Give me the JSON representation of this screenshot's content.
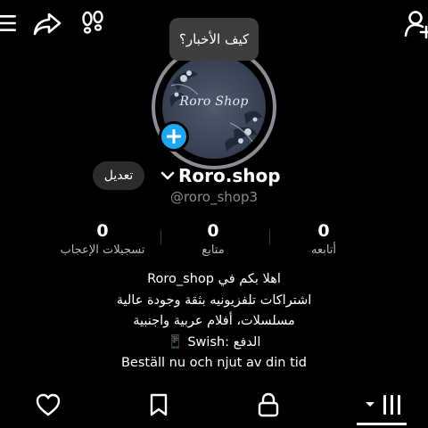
{
  "top_bar": {
    "icons": [
      "menu-icon",
      "share-icon",
      "footprints-icon",
      "add-user-icon"
    ]
  },
  "tooltip": {
    "text": "كيف الأخبار؟"
  },
  "profile": {
    "avatar_logo_text": "Roro Shop",
    "edit_label": "تعديل",
    "account_name": "Roro.shop",
    "username": "@roro_shop3"
  },
  "stats": {
    "likes": {
      "value": "0",
      "label": "تسجيلات الإعجاب"
    },
    "following": {
      "value": "0",
      "label": "متابع"
    },
    "followers": {
      "value": "0",
      "label": "أتابعه"
    }
  },
  "bio": {
    "line1": "اهلا بكم في Roro_shop",
    "line2": "اشتراكات تلفزيونيه بثقة وجودة عالية",
    "line3": "مسلسلات، أفلام عربية واجنبية",
    "line4": "الدفع :Swish 📱",
    "line5": "Beställ nu och njut av din tid"
  },
  "tabs": [
    "heart-icon",
    "bookmark-icon",
    "lock-icon",
    "grid-icon"
  ],
  "colors": {
    "background": "#000000",
    "accent": "#1ea7f0",
    "muted": "#8a8a8e"
  }
}
